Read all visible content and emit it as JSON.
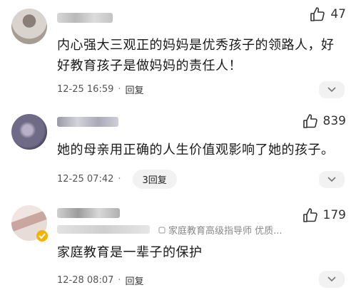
{
  "comments": [
    {
      "username": "",
      "text": "内心强大三观正的妈妈是优秀孩子的领路人，好好教育孩子是做妈妈的责任人！",
      "time": "12-25 16:59",
      "separator": "·",
      "reply_label": "回复",
      "likes": "47",
      "colors": {
        "avatar": "#b9b6ad",
        "username_blur": "#c9c9c9"
      },
      "icons": [
        "thumb-up-icon",
        "chevron-down-icon"
      ]
    },
    {
      "username": "",
      "text": "她的母亲用正确的人生价值观影响了她的孩子。",
      "time": "12-25 07:42",
      "separator": "·",
      "reply_label": "3回复",
      "likes": "839",
      "colors": {
        "avatar": "#6f6a86",
        "username_blur": "#b6b6c4"
      },
      "icons": [
        "thumb-up-icon",
        "chevron-down-icon"
      ]
    },
    {
      "username": "",
      "tag": "家庭教育高级指导师 优质...",
      "text": "家庭教育是一辈子的保护",
      "time": "12-28 08:07",
      "separator": "·",
      "reply_label": "回复",
      "likes": "179",
      "colors": {
        "avatar": "#d9c9c4",
        "badge": "#f2b400",
        "username_blur": "#c2c2c2"
      },
      "icons": [
        "thumb-up-icon",
        "chevron-down-icon",
        "verified-badge-icon",
        "tag-icon"
      ]
    }
  ]
}
